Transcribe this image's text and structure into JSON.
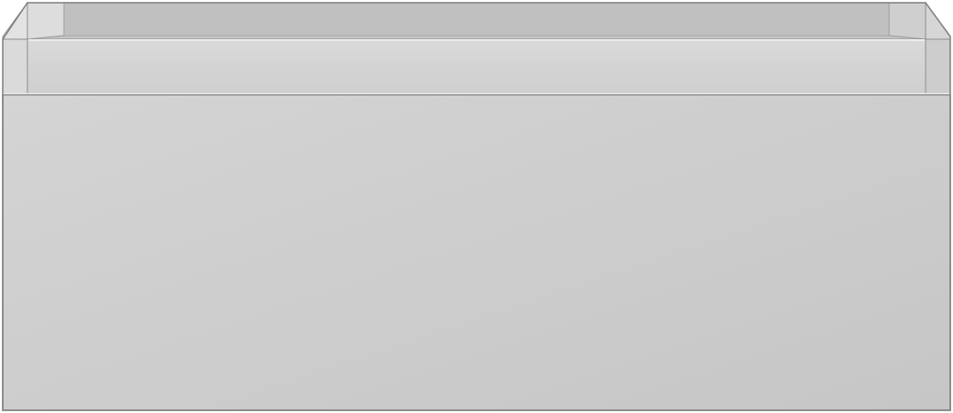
{
  "object": {
    "kind": "drawer-unit",
    "colors": {
      "background": "#ffffff",
      "outline": "#8e8e8e",
      "inner_back": "#bfbfbf",
      "inner_back_top": "#b3b3b3",
      "side_panel_left": "#dcdcdc",
      "side_panel_right": "#c9c9c9",
      "rim_front": "#d4d4d4",
      "rim_top_edge": "#e6e6e6",
      "drawer_front_light": "#d3d3d3",
      "drawer_front_dark": "#c6c6c6",
      "seam": "#efefef"
    }
  }
}
